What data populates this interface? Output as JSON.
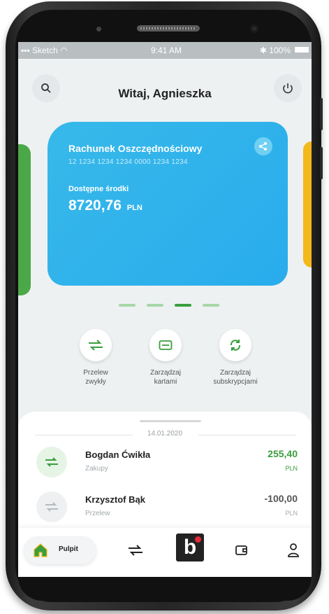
{
  "status_bar": {
    "carrier": "Sketch",
    "time": "9:41 AM",
    "battery": "100%"
  },
  "header": {
    "greeting": "Witaj, Agnieszka"
  },
  "account_card": {
    "name": "Rachunek Oszczędnościowy",
    "number": "12 1234 1234 1234 0000 1234 1234",
    "available_label": "Dostępne środki",
    "balance": "8720,76",
    "currency": "PLN"
  },
  "carousel": {
    "pages": 4,
    "active_index": 2
  },
  "actions": [
    {
      "label_line1": "Przelew",
      "label_line2": "zwykły"
    },
    {
      "label_line1": "Zarządzaj",
      "label_line2": "kartami"
    },
    {
      "label_line1": "Zarządzaj",
      "label_line2": "subskrypcjami"
    }
  ],
  "transactions": {
    "date": "14.01.2020",
    "items": [
      {
        "name": "Bogdan Ćwikła",
        "category": "Zakupy",
        "amount": "255,40",
        "currency": "PLN"
      },
      {
        "name": "Krzysztof Bąk",
        "category": "Przelew",
        "amount": "-100,00",
        "currency": "PLN"
      }
    ]
  },
  "bottom_nav": {
    "active_label": "Pulpit",
    "brand_glyph": "b"
  },
  "colors": {
    "card": "#29acec",
    "green": "#3a9e3e",
    "yellow": "#f3b81a",
    "red": "#e5293a"
  }
}
